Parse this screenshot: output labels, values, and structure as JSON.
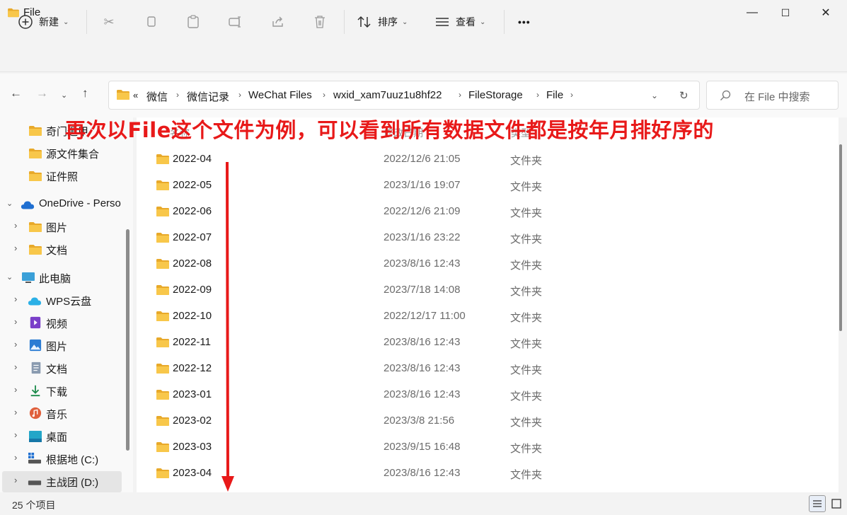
{
  "window": {
    "title": "File"
  },
  "window_controls": [
    "—",
    "☐",
    "✕"
  ],
  "toolbar": {
    "new_label": "新建",
    "sort_label": "排序",
    "view_label": "查看",
    "more": "•••"
  },
  "address": {
    "overflow": "«",
    "segments": [
      "微信",
      "微信记录",
      "WeChat Files",
      "wxid_xam7uuz1u8hf22",
      "FileStorage",
      "File"
    ]
  },
  "search": {
    "placeholder": "在 File 中搜索"
  },
  "sidebar": {
    "quick": [
      "奇门遁甲",
      "源文件集合",
      "证件照"
    ],
    "onedrive": "OneDrive - Perso",
    "onedrive_children": [
      "图片",
      "文档"
    ],
    "thispc": "此电脑",
    "pc_children": [
      "WPS云盘",
      "视频",
      "图片",
      "文档",
      "下载",
      "音乐",
      "桌面",
      "根据地 (C:)",
      "主战团 (D:)"
    ]
  },
  "columns": {
    "name": "名称",
    "date": "修改日期",
    "type": "类型"
  },
  "files": [
    {
      "name": "2022-04",
      "date": "2022/12/6 21:05",
      "type": "文件夹"
    },
    {
      "name": "2022-05",
      "date": "2023/1/16 19:07",
      "type": "文件夹"
    },
    {
      "name": "2022-06",
      "date": "2022/12/6 21:09",
      "type": "文件夹"
    },
    {
      "name": "2022-07",
      "date": "2023/1/16 23:22",
      "type": "文件夹"
    },
    {
      "name": "2022-08",
      "date": "2023/8/16 12:43",
      "type": "文件夹"
    },
    {
      "name": "2022-09",
      "date": "2023/7/18 14:08",
      "type": "文件夹"
    },
    {
      "name": "2022-10",
      "date": "2022/12/17 11:00",
      "type": "文件夹"
    },
    {
      "name": "2022-11",
      "date": "2023/8/16 12:43",
      "type": "文件夹"
    },
    {
      "name": "2022-12",
      "date": "2023/8/16 12:43",
      "type": "文件夹"
    },
    {
      "name": "2023-01",
      "date": "2023/8/16 12:43",
      "type": "文件夹"
    },
    {
      "name": "2023-02",
      "date": "2023/3/8 21:56",
      "type": "文件夹"
    },
    {
      "name": "2023-03",
      "date": "2023/9/15 16:48",
      "type": "文件夹"
    },
    {
      "name": "2023-04",
      "date": "2023/8/16 12:43",
      "type": "文件夹"
    }
  ],
  "annotation": "再次以File这个文件为例，可以看到所有数据文件都是按年月排好序的",
  "status": {
    "count": "25 个项目"
  },
  "colors": {
    "annotation": "#e81919",
    "folder": "#f8c74a",
    "folder_dark": "#e8a92a"
  }
}
